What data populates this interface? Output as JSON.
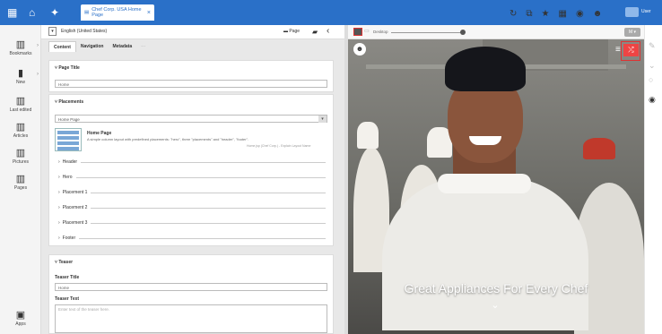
{
  "topbar": {
    "tab_title": "Chef Corp. USA Home Page",
    "user_label": "User"
  },
  "toolbar": {
    "language": "English (United States)",
    "page_button": "Page",
    "back": "‹",
    "forward": "›"
  },
  "sidebar": {
    "items": [
      {
        "label": "Bookmarks",
        "icon": "bookmarks-icon"
      },
      {
        "label": "New",
        "icon": "new-icon"
      },
      {
        "label": "Last edited",
        "icon": "last-edited-icon"
      },
      {
        "label": "Articles",
        "icon": "articles-icon"
      },
      {
        "label": "Pictures",
        "icon": "pictures-icon"
      },
      {
        "label": "Pages",
        "icon": "pages-icon"
      }
    ],
    "apps_label": "Apps"
  },
  "editor": {
    "tabs": [
      "Content",
      "Navigation",
      "Metadata",
      "···"
    ],
    "page_title": {
      "heading": "Page Title",
      "value": "Home"
    },
    "placements": {
      "heading": "Placements",
      "selected": "Home Page",
      "template_title": "Home Page",
      "template_desc": "A simple column layout with predefined placements: \"hero\", three \"placements\" and \"header\", \"footer\".",
      "template_meta": "Home.jsp (Chef Corp.) - Explain Layout Name",
      "rows": [
        "Header",
        "Hero",
        "Placement 1",
        "Placement 2",
        "Placement 3",
        "Footer"
      ]
    },
    "teaser": {
      "heading": "Teaser",
      "title_label": "Teaser Title",
      "title_value": "Home",
      "text_label": "Teaser Text",
      "text_placeholder": "Enter text of the teaser here."
    }
  },
  "preview": {
    "zoom_label": "Desktop",
    "device_btn": "M",
    "hero_title": "Great Appliances For Every Chef"
  },
  "colors": {
    "brand": "#2a70c8",
    "highlight": "#dd3333"
  }
}
